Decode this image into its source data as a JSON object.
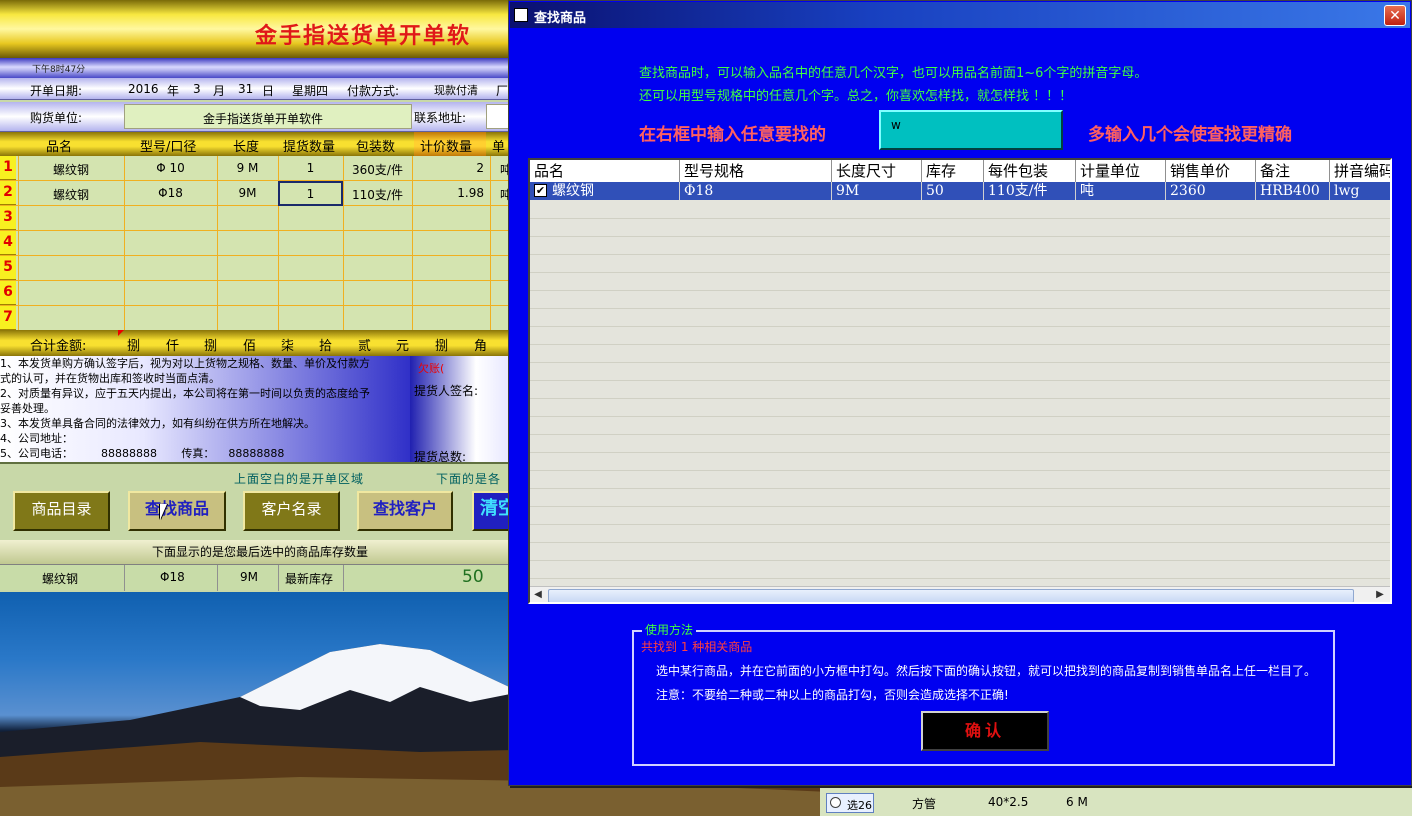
{
  "app": {
    "title": "金手指送货单开单软",
    "time": "下午8时47分"
  },
  "form": {
    "date_label": "开单日期:",
    "date_year": "2016",
    "year_unit": "年",
    "date_month": "3",
    "month_unit": "月",
    "date_day": "31",
    "day_unit": "日",
    "weekday": "星期四",
    "payment_label": "付款方式:",
    "payment_value": "现款付清",
    "payment_extra": "厂",
    "buyer_label": "购货单位:",
    "buyer_value": "金手指送货单开单软件",
    "address_label": "联系地址:"
  },
  "table": {
    "columns": [
      "品名",
      "型号/口径",
      "长度",
      "提货数量",
      "包装数",
      "计价数量",
      "单"
    ],
    "rows": [
      {
        "num": "1",
        "name": "螺纹钢",
        "model": "Φ 10",
        "length": "9 M",
        "qty": "1",
        "pack": "360支/件",
        "price_qty": "2",
        "unit": "吨"
      },
      {
        "num": "2",
        "name": "螺纹钢",
        "model": "Φ18",
        "length": "9M",
        "qty": "1",
        "pack": "110支/件",
        "price_qty": "1.98",
        "unit": "吨"
      },
      {
        "num": "3"
      },
      {
        "num": "4"
      },
      {
        "num": "5"
      },
      {
        "num": "6"
      },
      {
        "num": "7"
      }
    ],
    "total_label": "合计金额:",
    "total_units": [
      "捌",
      "仟",
      "捌",
      "佰",
      "柒",
      "拾",
      "贰",
      "元",
      "捌",
      "角"
    ]
  },
  "notes": [
    "1、本发货单购方确认签字后，视为对以上货物之规格、数量、单价及付款方",
    "式的认可，并在货物出库和签收时当面点清。",
    "2、对质量有异议，应于五天内提出，本公司将在第一时间以负责的态度给予",
    "妥善处理。",
    "3、本发货单具备合同的法律效力，如有纠纷在供方所在地解决。",
    "4、公司地址：",
    "5、公司电话：        88888888       传真：    88888888"
  ],
  "signature": {
    "debt": "欠账(",
    "picker": "提货人签名:",
    "total_qty": "提货总数:"
  },
  "buttons": {
    "hint_left": "上面空白的是开单区域",
    "hint_right": "下面的是各",
    "catalog": "商品目录",
    "find_goods": "查找商品",
    "customers": "客户名录",
    "find_customer": "查找客户",
    "clear": "清空"
  },
  "stock": {
    "header": "下面显示的是您最后选中的商品库存数量",
    "name": "螺纹钢",
    "model": "Φ18",
    "length": "9M",
    "label": "最新库存",
    "value": "50"
  },
  "bottom_row": {
    "radio": "选26",
    "name": "方管",
    "spec": "40*2.5",
    "length": "6 M"
  },
  "dialog": {
    "title": "查找商品",
    "close": "✕",
    "hint1": "查找商品时，可以输入品名中的任意几个汉字，也可以用品名前面1~6个字的拼音字母。",
    "hint2": "还可以用型号规格中的任意几个字。总之，你喜欢怎样找，就怎样找 ！！！",
    "input_label": "在右框中输入任意要找的",
    "search_value": "w",
    "more_hint": "多输入几个会使查找更精确",
    "columns": [
      "品名",
      "型号规格",
      "长度尺寸",
      "库存",
      "每件包装",
      "计量单位",
      "销售单价",
      "备注",
      "拼音编码"
    ],
    "result": {
      "checked": true,
      "name": "螺纹钢",
      "model": "Φ18",
      "length": "9M",
      "stock": "50",
      "pack": "110支/件",
      "unit": "吨",
      "price": "2360",
      "remark": "HRB400",
      "pinyin": "lwg"
    },
    "usage_legend": "使用方法",
    "found": "共找到 1 种相关商品",
    "usage1": "选中某行商品，并在它前面的小方框中打勾。然后按下面的确认按钮，就可以把找到的商品复制到销售单品名上任一栏目了。",
    "usage2": "注意：不要给二种或二种以上的商品打勾，否则会造成选择不正确!",
    "confirm": "确认"
  },
  "colors": {
    "dialog_bg": "#0000f0",
    "hint_green": "#40ff40",
    "accent_red": "#ff6060",
    "selection": "#3050b8"
  }
}
